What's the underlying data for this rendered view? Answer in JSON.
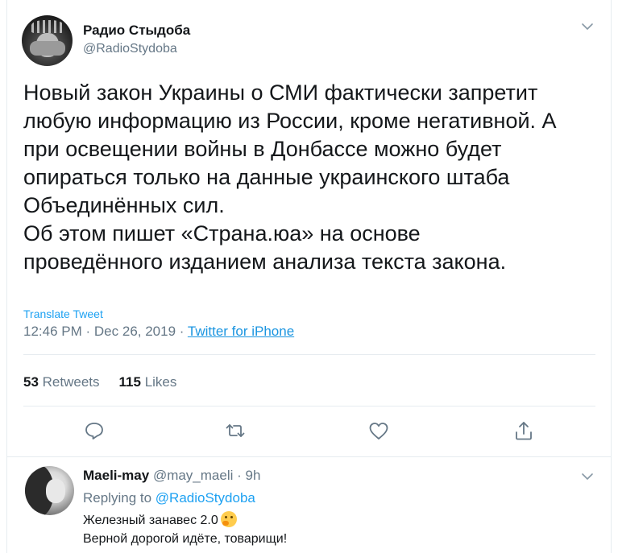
{
  "tweet": {
    "author_name": "Радио Стыдоба",
    "author_handle": "@RadioStydoba",
    "text": "Новый закон Украины о СМИ фактически запретит\nлюбую информацию из России, кроме негативной. А\nпри освещении войны в Донбассе можно будет\nопираться только на данные украинского штаба\nОбъединённых сил.\nОб этом пишет «Страна.юа» на основе\nпроведённого изданием анализа текста закона.",
    "translate_label": "Translate Tweet",
    "time": "12:46 PM",
    "date": "Dec 26, 2019",
    "separator": "·",
    "source": "Twitter for iPhone",
    "retweets_count": "53",
    "retweets_label": "Retweets",
    "likes_count": "115",
    "likes_label": "Likes"
  },
  "actions": {
    "reply_icon": "comment-icon",
    "retweet_icon": "retweet-icon",
    "like_icon": "heart-icon",
    "share_icon": "share-icon"
  },
  "reply": {
    "author_name": "Maeli-may",
    "author_handle": "@may_maeli",
    "separator": "·",
    "time": "9h",
    "replying_to_label": "Replying to",
    "replying_to_handle": "@RadioStydoba",
    "line1": "Железный занавес 2.0",
    "line1_emoji": "thinking-face-emoji",
    "line2": "Верной дорогой идёте, товарищи!"
  },
  "colors": {
    "text": "#14171a",
    "secondary": "#657786",
    "link": "#1da1f2",
    "border": "#e6ecf0"
  }
}
